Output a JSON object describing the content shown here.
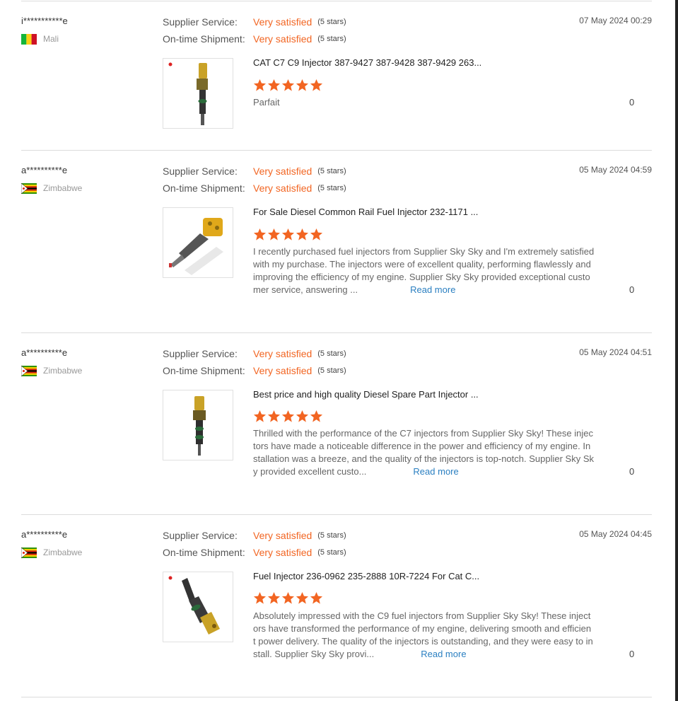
{
  "labels": {
    "supplier_service": "Supplier Service:",
    "ontime_shipment": "On-time Shipment:"
  },
  "colors": {
    "accent": "#f26522",
    "link": "#2a7fc1",
    "divider": "#dcdcdc"
  },
  "reviews": [
    {
      "buyer": "i***********e",
      "country": "Mali",
      "flag": "mali-flag-icon",
      "date": "07 May 2024 00:29",
      "supplier_service": "Very satisfied",
      "supplier_service_stars": "(5 stars)",
      "ontime_shipment": "Very satisfied",
      "ontime_shipment_stars": "(5 stars)",
      "product_title": "CAT C7 C9 Injector 387-9427 387-9428 387-9429 263...",
      "rating": 5,
      "text": "Parfait",
      "read_more": "",
      "helpful": "0"
    },
    {
      "buyer": "a**********e",
      "country": "Zimbabwe",
      "flag": "zimbabwe-flag-icon",
      "date": "05 May 2024 04:59",
      "supplier_service": "Very satisfied",
      "supplier_service_stars": "(5 stars)",
      "ontime_shipment": "Very satisfied",
      "ontime_shipment_stars": "(5 stars)",
      "product_title": "For Sale Diesel Common Rail Fuel Injector 232-1171 ...",
      "rating": 5,
      "text_lines": [
        "I recently purchased fuel injectors from Supplier Sky Sky and I'm extremely satisfied",
        "with my purchase. The injectors were of excellent quality, performing flawlessly and",
        "improving the efficiency of my engine. Supplier Sky Sky provided exceptional custo",
        "mer service, answering ..."
      ],
      "read_more": "Read more",
      "helpful": "0"
    },
    {
      "buyer": "a**********e",
      "country": "Zimbabwe",
      "flag": "zimbabwe-flag-icon",
      "date": "05 May 2024 04:51",
      "supplier_service": "Very satisfied",
      "supplier_service_stars": "(5 stars)",
      "ontime_shipment": "Very satisfied",
      "ontime_shipment_stars": "(5 stars)",
      "product_title": "Best price and high quality Diesel Spare Part Injector ...",
      "rating": 5,
      "text_lines": [
        "Thrilled with the performance of the C7 injectors from Supplier Sky Sky! These injec",
        "tors have made a noticeable difference in the power and efficiency of my engine. In",
        "stallation was a breeze, and the quality of the injectors is top-notch. Supplier Sky Sk",
        "y provided excellent custo..."
      ],
      "read_more": "Read more",
      "helpful": "0"
    },
    {
      "buyer": "a**********e",
      "country": "Zimbabwe",
      "flag": "zimbabwe-flag-icon",
      "date": "05 May 2024 04:45",
      "supplier_service": "Very satisfied",
      "supplier_service_stars": "(5 stars)",
      "ontime_shipment": "Very satisfied",
      "ontime_shipment_stars": "(5 stars)",
      "product_title": "Fuel Injector 236-0962 235-2888 10R-7224 For Cat C...",
      "rating": 5,
      "text_lines": [
        "Absolutely impressed with the C9 fuel injectors from Supplier Sky Sky! These inject",
        "ors have transformed the performance of my engine, delivering smooth and efficien",
        "t power delivery. The quality of the injectors is outstanding, and they were easy to in",
        "stall. Supplier Sky Sky provi..."
      ],
      "read_more": "Read more",
      "helpful": "0"
    }
  ]
}
